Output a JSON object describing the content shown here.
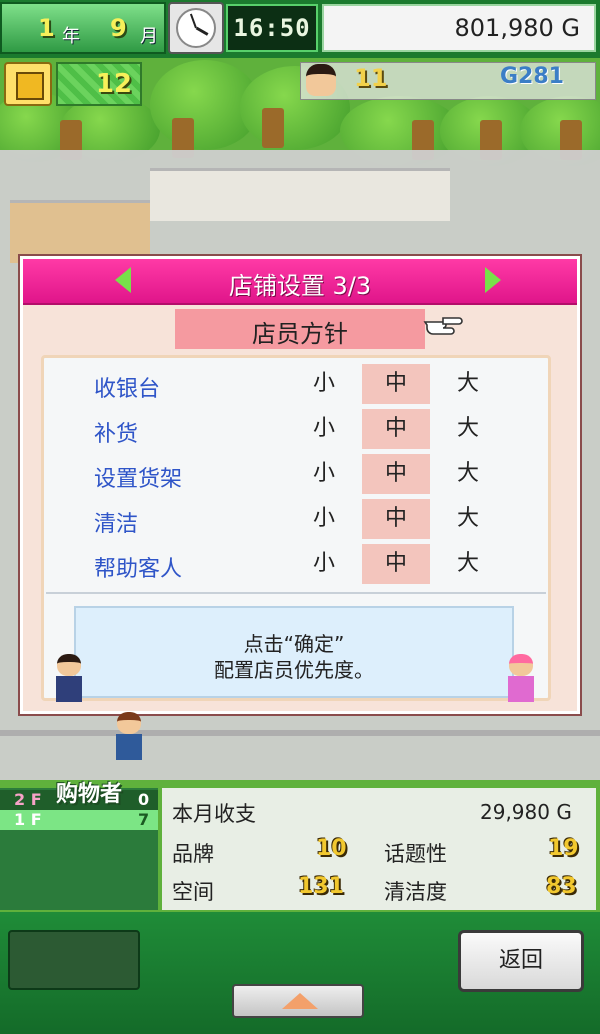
{
  "topbar": {
    "year_value": "1",
    "year_unit": "年",
    "month_value": "9",
    "month_unit": "月",
    "time": "16:50",
    "money": "801,980 G"
  },
  "status": {
    "rank_value": "12",
    "staff_count": "11",
    "points": "G281"
  },
  "dialog": {
    "title": "店铺设置 3/3",
    "subtitle": "店员方针",
    "rows": [
      {
        "label": "收银台",
        "options": [
          "小",
          "中",
          "大"
        ],
        "selected": "中"
      },
      {
        "label": "补货",
        "options": [
          "小",
          "中",
          "大"
        ],
        "selected": "中"
      },
      {
        "label": "设置货架",
        "options": [
          "小",
          "中",
          "大"
        ],
        "selected": "中"
      },
      {
        "label": "清洁",
        "options": [
          "小",
          "中",
          "大"
        ],
        "selected": "中"
      },
      {
        "label": "帮助客人",
        "options": [
          "小",
          "中",
          "大"
        ],
        "selected": "中"
      }
    ],
    "tip_line1": "点击“确定”",
    "tip_line2": "配置店员优先度。"
  },
  "floors": {
    "shopper_label": "购物者",
    "rows": [
      {
        "floor": "2 F",
        "count": "0"
      },
      {
        "floor": "1 F",
        "count": "7"
      }
    ]
  },
  "stats": {
    "monthly_label": "本月收支",
    "monthly_value": "29,980 G",
    "brand_label": "品牌",
    "brand_value": "10",
    "topic_label": "话题性",
    "topic_value": "19",
    "space_label": "空间",
    "space_value": "131",
    "clean_label": "清洁度",
    "clean_value": "83"
  },
  "buttons": {
    "back_label": "返回"
  },
  "colors": {
    "header_pink": "#e0158a",
    "selected_option": "#f3c5bd",
    "label_blue": "#2f55c8",
    "stat_gold": "#f2c82f"
  },
  "icons": [
    "clock-icon",
    "shirt-icon",
    "staff-face-icon",
    "pointing-hand-icon",
    "arrow-left-icon",
    "arrow-right-icon",
    "up-arrow-icon"
  ]
}
